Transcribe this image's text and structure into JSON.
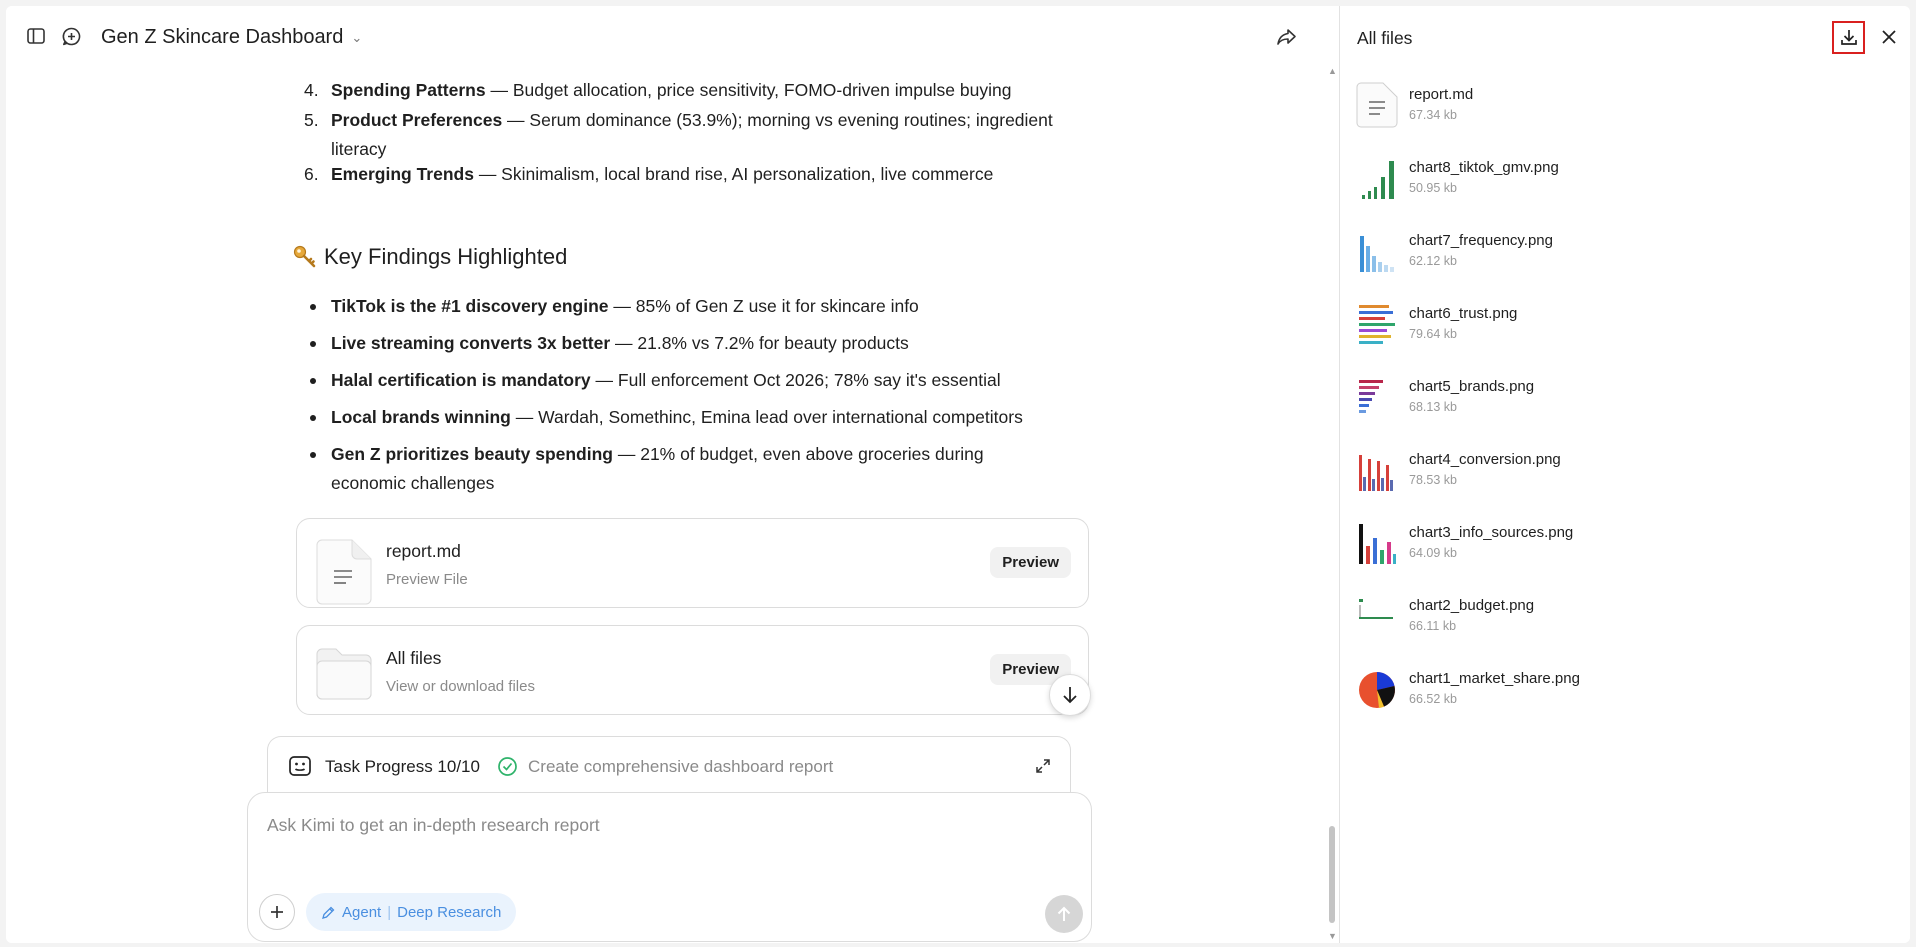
{
  "header": {
    "title": "Gen Z Skincare Dashboard"
  },
  "list": [
    {
      "num": "4.",
      "bold": "Spending Patterns",
      "rest": " — Budget allocation, price sensitivity, FOMO-driven impulse buying"
    },
    {
      "num": "5.",
      "bold": "Product Preferences",
      "rest": " — Serum dominance (53.9%); morning vs evening routines; ingredient literacy"
    },
    {
      "num": "6.",
      "bold": "Emerging Trends",
      "rest": " — Skinimalism, local brand rise, AI personalization, live commerce"
    }
  ],
  "findings": {
    "heading": "Key Findings Highlighted",
    "icon": "key-icon",
    "items": [
      {
        "bold": "TikTok is the #1 discovery engine",
        "rest": " — 85% of Gen Z use it for skincare info"
      },
      {
        "bold": "Live streaming converts 3x better",
        "rest": " — 21.8% vs 7.2% for beauty products"
      },
      {
        "bold": "Halal certification is mandatory",
        "rest": " — Full enforcement Oct 2026; 78% say it's essential"
      },
      {
        "bold": "Local brands winning",
        "rest": " — Wardah, Somethinc, Emina lead over international competitors"
      },
      {
        "bold": "Gen Z prioritizes beauty spending",
        "rest": " — 21% of budget, even above groceries during economic challenges"
      }
    ]
  },
  "cards": [
    {
      "name": "report.md",
      "sub": "Preview File",
      "button": "Preview",
      "icon": "document-icon"
    },
    {
      "name": "All files",
      "sub": "View or download files",
      "button": "Preview",
      "icon": "folder-icon"
    }
  ],
  "task": {
    "label": "Task Progress 10/10",
    "desc": "Create comprehensive dashboard report"
  },
  "composer": {
    "placeholder": "Ask Kimi to get an in-depth research report",
    "agent_label": "Agent",
    "mode_label": "Deep Research"
  },
  "files_panel": {
    "title": "All files",
    "files": [
      {
        "name": "report.md",
        "size": "67.34 kb",
        "kind": "doc"
      },
      {
        "name": "chart8_tiktok_gmv.png",
        "size": "50.95 kb",
        "kind": "green-bars"
      },
      {
        "name": "chart7_frequency.png",
        "size": "62.12 kb",
        "kind": "blue-bars"
      },
      {
        "name": "chart6_trust.png",
        "size": "79.64 kb",
        "kind": "hbars"
      },
      {
        "name": "chart5_brands.png",
        "size": "68.13 kb",
        "kind": "hbars-red"
      },
      {
        "name": "chart4_conversion.png",
        "size": "78.53 kb",
        "kind": "red-bars"
      },
      {
        "name": "chart3_info_sources.png",
        "size": "64.09 kb",
        "kind": "multi-bars"
      },
      {
        "name": "chart2_budget.png",
        "size": "66.11 kb",
        "kind": "minimal"
      },
      {
        "name": "chart1_market_share.png",
        "size": "66.52 kb",
        "kind": "pie"
      }
    ]
  },
  "colors": {
    "accent": "#4a8fe0",
    "highlight": "#d9201f",
    "check": "#2fb36b"
  }
}
